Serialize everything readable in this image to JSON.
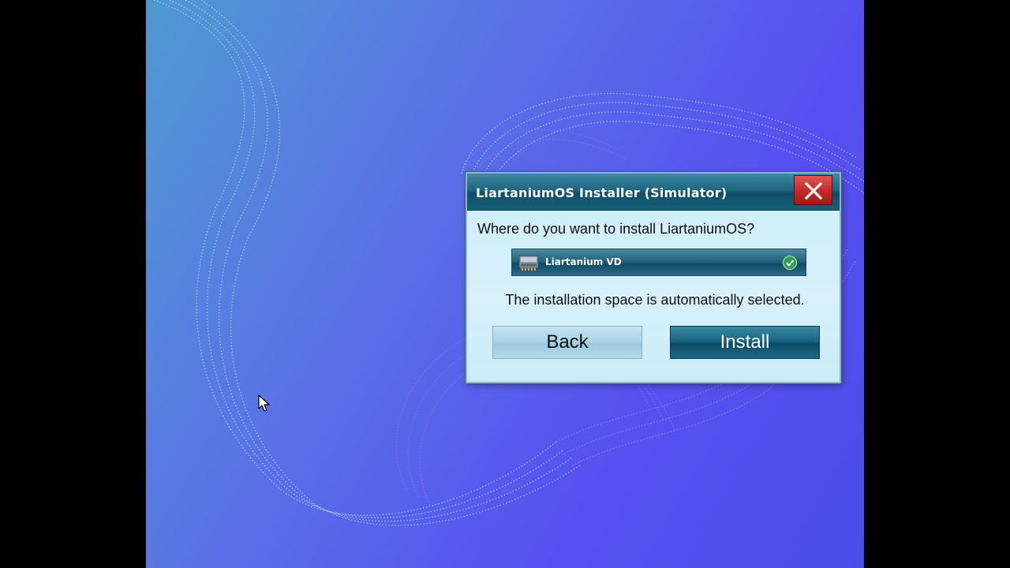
{
  "dialog": {
    "title": "LiartaniumOS Installer (Simulator)",
    "question": "Where do you want to install LiartaniumOS?",
    "drive": {
      "label": "Liartanium VD",
      "icon": "hard-drive-icon",
      "status_icon": "checkmark-icon",
      "selected": true
    },
    "info": "The installation space is automatically selected.",
    "back_label": "Back",
    "install_label": "Install",
    "close_icon": "close-icon"
  },
  "colors": {
    "titlebar": "#1e6582",
    "close_button": "#c82a2a",
    "dialog_body": "#d8f1fb",
    "check": "#2ea44f"
  }
}
